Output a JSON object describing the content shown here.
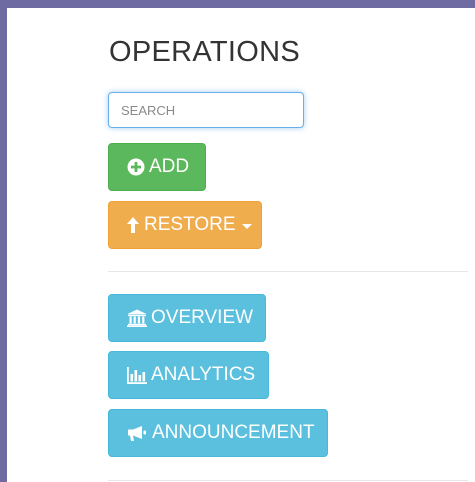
{
  "section": {
    "title": "OPERATIONS"
  },
  "search": {
    "placeholder": "SEARCH",
    "value": ""
  },
  "buttons": {
    "add": {
      "label": "ADD",
      "icon": "plus-circle-icon",
      "color": "#5cb85c"
    },
    "restore": {
      "label": "RESTORE",
      "icon": "arrow-up-icon",
      "color": "#f0ad4e"
    },
    "overview": {
      "label": "OVERVIEW",
      "icon": "bank-icon",
      "color": "#5bc0de"
    },
    "analytics": {
      "label": "ANALYTICS",
      "icon": "bar-chart-icon",
      "color": "#5bc0de"
    },
    "announcement": {
      "label": "ANNOUNCEMENT",
      "icon": "bullhorn-icon",
      "color": "#5bc0de"
    }
  },
  "colors": {
    "page_background": "#6d6ba1",
    "panel_background": "#ffffff",
    "focus_border": "#66afe9"
  }
}
